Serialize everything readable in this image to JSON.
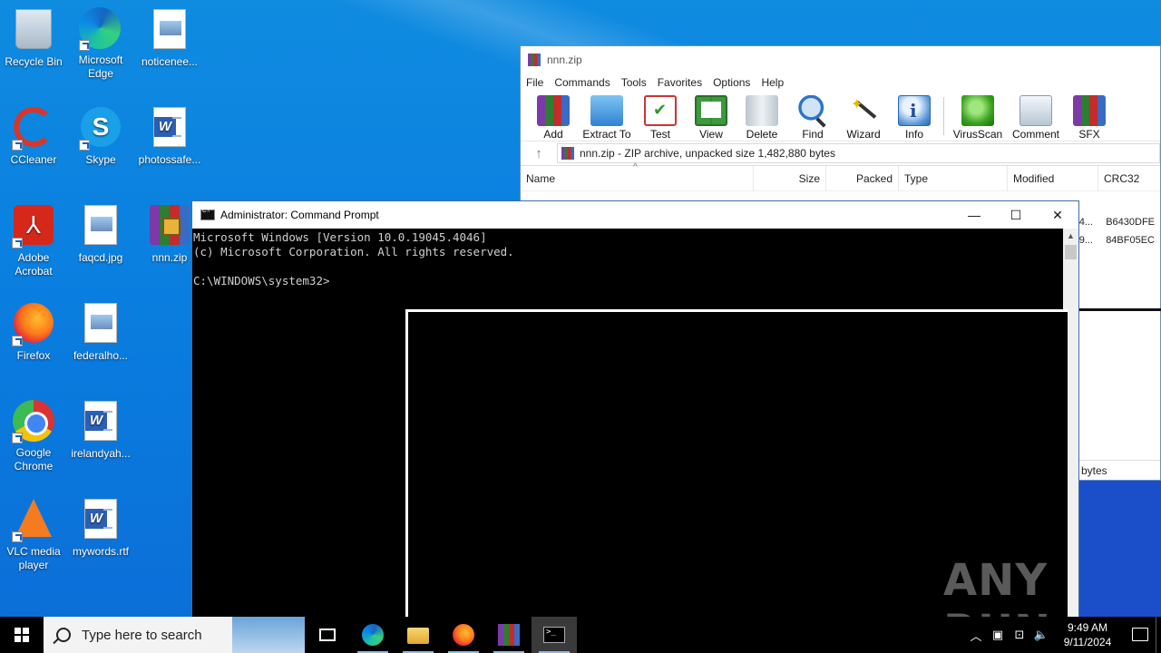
{
  "desktop": {
    "icons": [
      {
        "label": "Recycle Bin",
        "icon": "recycle-bin-icon"
      },
      {
        "label": "Microsoft Edge",
        "icon": "edge-icon"
      },
      {
        "label": "noticenee...",
        "icon": "image-file-icon"
      },
      {
        "label": "CCleaner",
        "icon": "ccleaner-icon"
      },
      {
        "label": "Skype",
        "icon": "skype-icon"
      },
      {
        "label": "photossafe...",
        "icon": "word-doc-icon"
      },
      {
        "label": "Adobe Acrobat",
        "icon": "acrobat-icon"
      },
      {
        "label": "faqcd.jpg",
        "icon": "image-file-icon"
      },
      {
        "label": "nnn.zip",
        "icon": "winrar-archive-icon"
      },
      {
        "label": "Firefox",
        "icon": "firefox-icon"
      },
      {
        "label": "federalho...",
        "icon": "image-file-icon"
      },
      {
        "label": "Google Chrome",
        "icon": "chrome-icon"
      },
      {
        "label": "irelandyah...",
        "icon": "word-doc-icon"
      },
      {
        "label": "VLC media player",
        "icon": "vlc-icon"
      },
      {
        "label": "mywords.rtf",
        "icon": "word-doc-icon"
      }
    ]
  },
  "winrar": {
    "title": "nnn.zip",
    "menu": [
      "File",
      "Commands",
      "Tools",
      "Favorites",
      "Options",
      "Help"
    ],
    "toolbar": [
      "Add",
      "Extract To",
      "Test",
      "View",
      "Delete",
      "Find",
      "Wizard",
      "Info",
      "VirusScan",
      "Comment",
      "SFX"
    ],
    "path": "nnn.zip - ZIP archive, unpacked size 1,482,880 bytes",
    "columns": [
      "Name",
      "Size",
      "Packed",
      "Type",
      "Modified",
      "CRC32"
    ],
    "rows": [
      {
        "modified_partial": "4...",
        "crc": "B6430DFE"
      },
      {
        "modified_partial": "9...",
        "crc": "84BF05EC"
      }
    ],
    "status_partial": "bytes"
  },
  "cmd": {
    "title": "Administrator: Command Prompt",
    "lines": [
      "Microsoft Windows [Version 10.0.19045.4046]",
      "(c) Microsoft Corporation. All rights reserved.",
      "",
      "C:\\WINDOWS\\system32>"
    ]
  },
  "watermark": "ANY RUN",
  "taskbar": {
    "search_placeholder": "Type here to search",
    "time": "9:49 AM",
    "date": "9/11/2024"
  }
}
